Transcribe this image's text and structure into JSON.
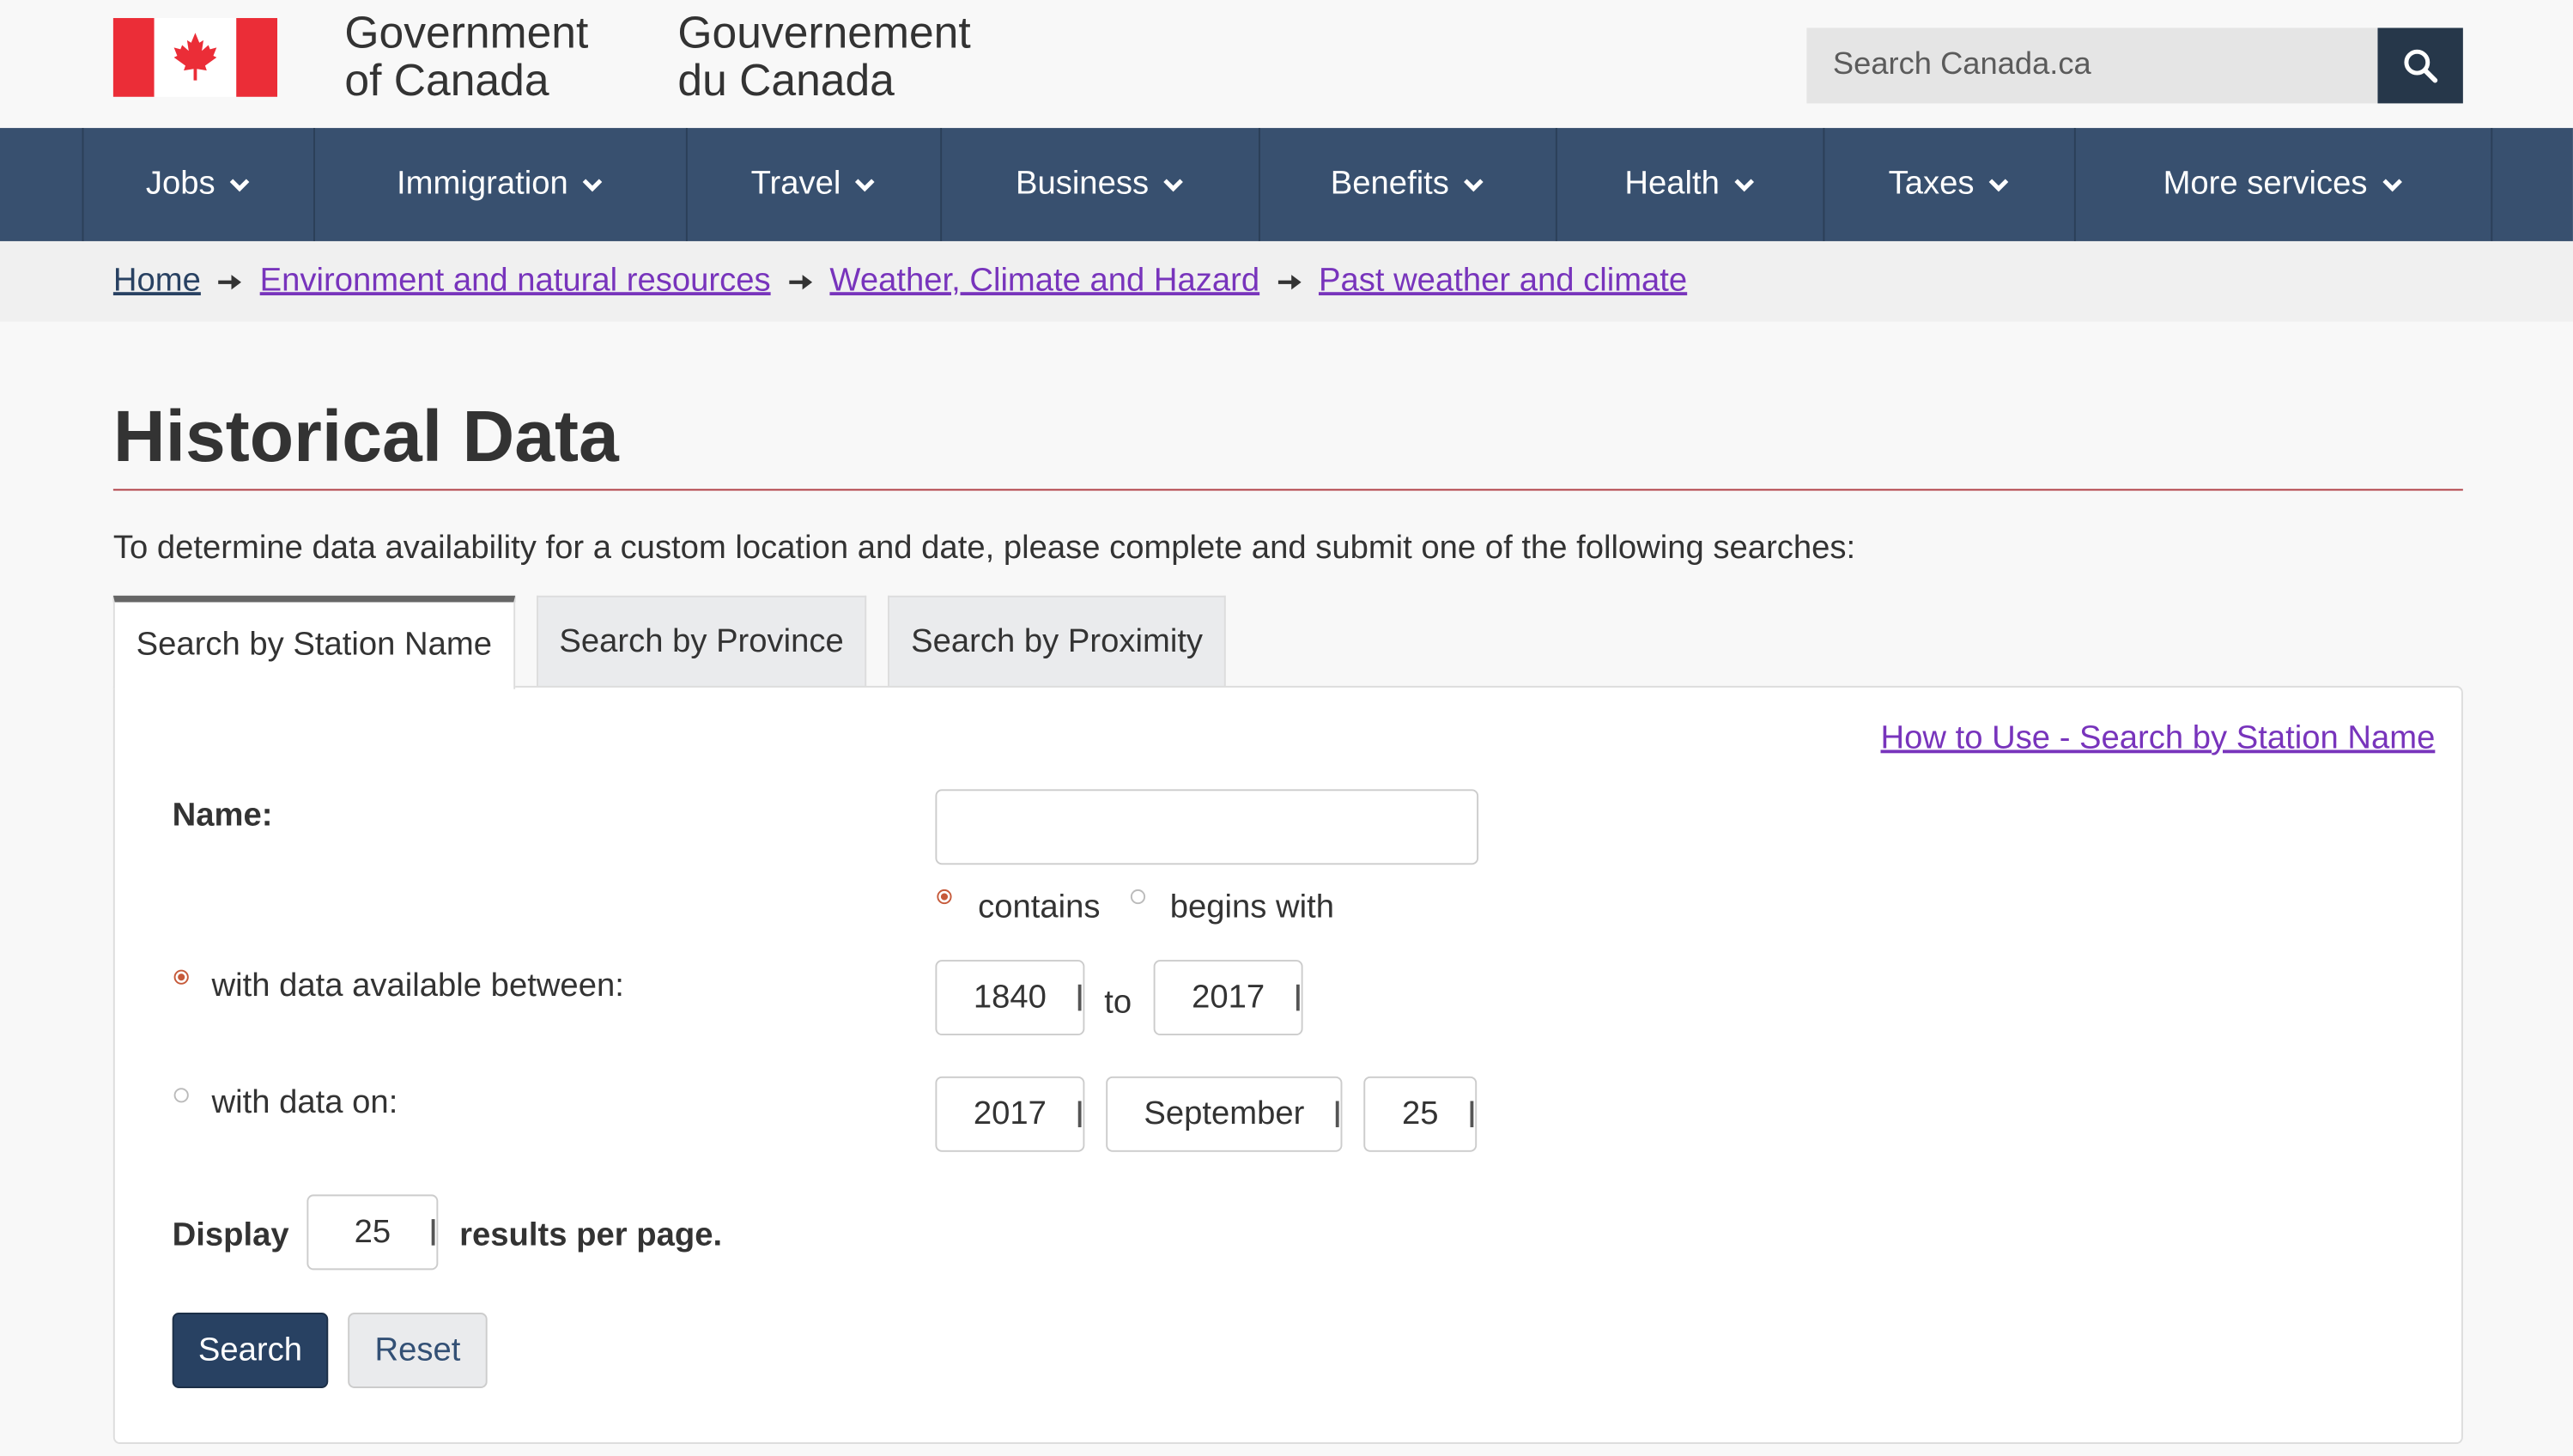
{
  "header": {
    "signature_en_line1": "Government",
    "signature_en_line2": "of Canada",
    "signature_fr_line1": "Gouvernement",
    "signature_fr_line2": "du Canada",
    "search_placeholder": "Search Canada.ca",
    "flag_icon": "canada-flag",
    "search_icon": "magnifier"
  },
  "nav": {
    "items": [
      {
        "label": "Jobs"
      },
      {
        "label": "Immigration"
      },
      {
        "label": "Travel"
      },
      {
        "label": "Business"
      },
      {
        "label": "Benefits"
      },
      {
        "label": "Health"
      },
      {
        "label": "Taxes"
      },
      {
        "label": "More services"
      }
    ]
  },
  "breadcrumb": [
    {
      "label": "Home"
    },
    {
      "label": "Environment and natural resources"
    },
    {
      "label": "Weather, Climate and Hazard"
    },
    {
      "label": "Past weather and climate"
    }
  ],
  "page": {
    "title": "Historical Data",
    "intro": "To determine data availability for a custom location and date, please complete and submit one of the following searches:"
  },
  "tabs": [
    {
      "label": "Search by Station Name",
      "active": true
    },
    {
      "label": "Search by Province",
      "active": false
    },
    {
      "label": "Search by Proximity",
      "active": false
    }
  ],
  "form": {
    "help_link": "How to Use - Search by Station Name",
    "name_label": "Name:",
    "name_value": "",
    "match_contains": "contains",
    "match_begins": "begins with",
    "match_selected": "contains",
    "range_label": "with data available between:",
    "range_from": "1840",
    "range_to_word": "to",
    "range_to": "2017",
    "on_label": "with data on:",
    "on_year": "2017",
    "on_month": "September",
    "on_day": "25",
    "date_mode_selected": "range",
    "display_label": "Display",
    "display_value": "25",
    "display_suffix": "results per page.",
    "search_button": "Search",
    "reset_button": "Reset"
  },
  "colors": {
    "nav_bg": "#38506f",
    "flag_red": "#eb2d37",
    "title_rule": "#af3c43",
    "visited_link": "#7834bc",
    "primary_button": "#284162"
  }
}
